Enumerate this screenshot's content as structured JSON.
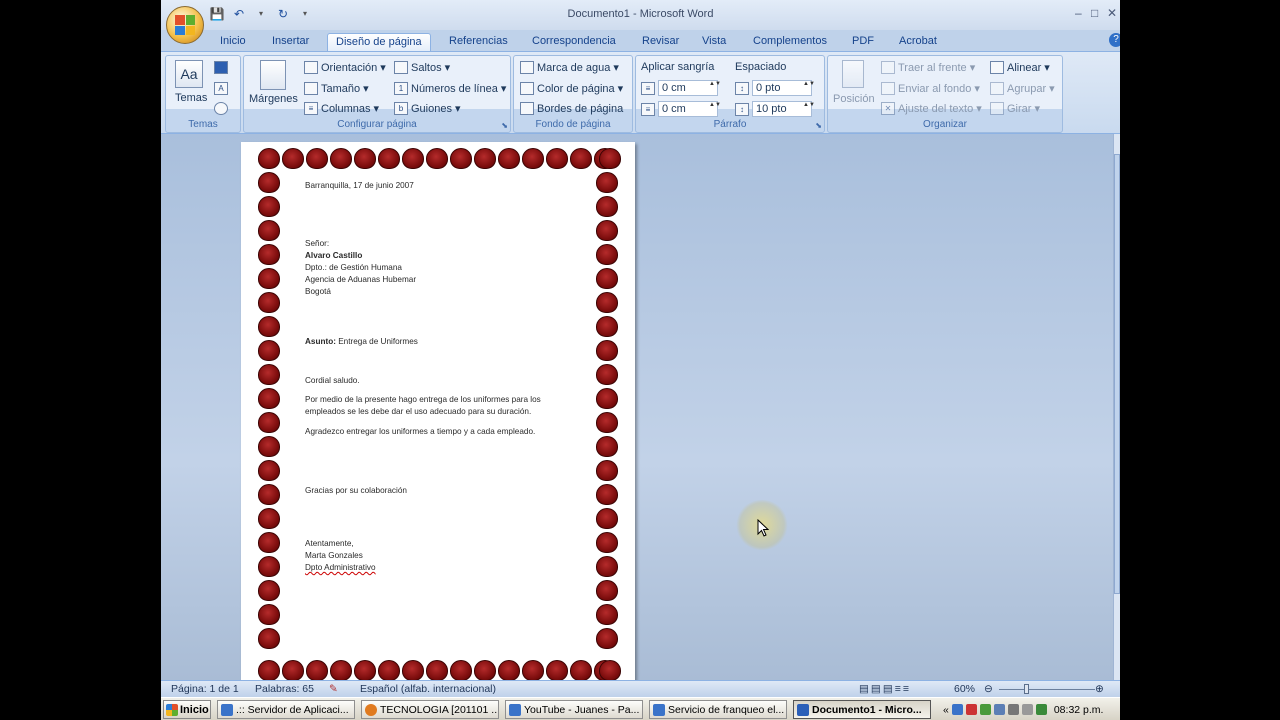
{
  "window": {
    "title": "Documento1 - Microsoft Word",
    "minimize": "–",
    "maximize": "□",
    "close": "✕"
  },
  "qat": {
    "save_icon": "save-icon",
    "undo_icon": "undo-icon",
    "redo_icon": "redo-icon"
  },
  "tabs": [
    {
      "label": "Inicio"
    },
    {
      "label": "Insertar"
    },
    {
      "label": "Diseño de página"
    },
    {
      "label": "Referencias"
    },
    {
      "label": "Correspondencia"
    },
    {
      "label": "Revisar"
    },
    {
      "label": "Vista"
    },
    {
      "label": "Complementos"
    },
    {
      "label": "PDF"
    },
    {
      "label": "Acrobat"
    }
  ],
  "ribbon": {
    "temas": {
      "label": "Temas",
      "button": "Temas",
      "sample": "Aa"
    },
    "configurar": {
      "label": "Configurar página",
      "margenes": "Márgenes",
      "orientacion": "Orientación",
      "tamano": "Tamaño",
      "columnas": "Columnas",
      "saltos": "Saltos",
      "numeros_linea": "Números de línea",
      "guiones": "Guiones"
    },
    "fondo": {
      "label": "Fondo de página",
      "marca_agua": "Marca de agua",
      "color_pagina": "Color de página",
      "bordes_pagina": "Bordes de página"
    },
    "parrafo": {
      "label": "Párrafo",
      "sangria_title": "Aplicar sangría",
      "sangria_izq": "0 cm",
      "sangria_der": "0 cm",
      "espaciado_title": "Espaciado",
      "espaciado_antes": "0 pto",
      "espaciado_despues": "10 pto"
    },
    "organizar": {
      "label": "Organizar",
      "posicion": "Posición",
      "traer_frente": "Traer al frente",
      "enviar_fondo": "Enviar al fondo",
      "ajuste_texto": "Ajuste del texto",
      "alinear": "Alinear",
      "agrupar": "Agrupar",
      "girar": "Girar"
    }
  },
  "letter": {
    "date": "Barranquilla, 17 de junio 2007",
    "salutation": "Señor:",
    "recipient_name": "Alvaro Castillo",
    "recipient_dept": "Dpto.: de Gestión Humana",
    "recipient_company": "Agencia de Aduanas Hubemar",
    "recipient_city": "Bogotá",
    "subject_label": "Asunto:",
    "subject_text": " Entrega de Uniformes",
    "greeting": "Cordial saludo.",
    "body1_line1": "Por medio de la presente hago entrega de los uniformes para los",
    "body1_line2": "empleados se les debe dar el uso adecuado para su duración.",
    "body2": "Agradezco entregar los uniformes a tiempo y a cada empleado.",
    "thanks": "Gracias por su colaboración",
    "closing": "Atentamente,",
    "sender_name": "Marta Gonzales",
    "sender_dept": "Dpto Administrativo"
  },
  "status": {
    "page": "Página: 1 de 1",
    "words": "Palabras: 65",
    "language": "Español (alfab. internacional)",
    "zoom": "60%"
  },
  "taskbar": {
    "start": "Inicio",
    "tasks": [
      {
        "label": ".:: Servidor de Aplicaci..."
      },
      {
        "label": "TECNOLOGIA [201101 ..."
      },
      {
        "label": "YouTube - Juanes - Pa..."
      },
      {
        "label": "Servicio de franqueo el..."
      },
      {
        "label": "Documento1 - Micro..."
      }
    ],
    "clock": "08:32 p.m.",
    "tray_expand": "«"
  },
  "colors": {
    "ribbon_text": "#1e395b",
    "tab_text": "#15428b",
    "leaf_red": "#8a1212"
  }
}
